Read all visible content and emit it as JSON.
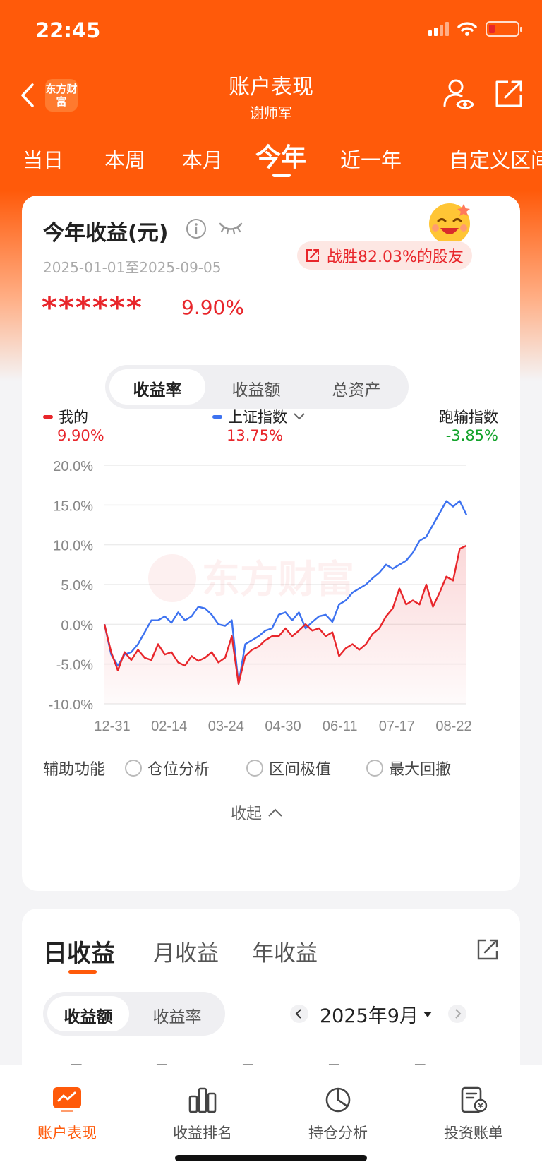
{
  "status_bar": {
    "time": "22:45"
  },
  "header": {
    "logo_text": "东方财富",
    "title": "账户表现",
    "subtitle": "谢师军"
  },
  "period_tabs": [
    {
      "label": "当日"
    },
    {
      "label": "本周"
    },
    {
      "label": "本月"
    },
    {
      "label": "今年",
      "active": true
    },
    {
      "label": "近一年"
    },
    {
      "label": "自定义区间"
    }
  ],
  "summary": {
    "title": "今年收益(元)",
    "date_range": "2025-01-01至2025-09-05",
    "badge": "战胜82.03%的股友",
    "masked_amount": "******",
    "rate": "9.90%",
    "segments": [
      "收益率",
      "收益额",
      "总资产"
    ],
    "selected_segment": "收益率"
  },
  "legend": {
    "mine": {
      "label": "我的",
      "value": "9.90%",
      "color": "#e8262b"
    },
    "index": {
      "label": "上证指数",
      "value": "13.75%",
      "color": "#3d72f0"
    },
    "diff": {
      "label": "跑输指数",
      "value": "-3.85%",
      "color": "#12a32a"
    }
  },
  "chart_data": {
    "type": "line",
    "watermark": "东方财富",
    "x_ticks": [
      "12-31",
      "02-14",
      "03-24",
      "04-30",
      "06-11",
      "07-17",
      "08-22"
    ],
    "y_ticks": [
      "20.0%",
      "15.0%",
      "10.0%",
      "5.0%",
      "0.0%",
      "-5.0%",
      "-10.0%"
    ],
    "ylim": [
      -10,
      20
    ],
    "series": [
      {
        "name": "我的",
        "color": "#e8262b",
        "values": [
          0,
          -3.5,
          -5.8,
          -3.5,
          -4.5,
          -3.2,
          -4.2,
          -4.5,
          -2.5,
          -3.8,
          -3.5,
          -4.8,
          -5.2,
          -4.0,
          -4.6,
          -4.2,
          -3.5,
          -4.8,
          -4.2,
          -1.5,
          -7.5,
          -4.0,
          -3.2,
          -2.8,
          -2.0,
          -1.5,
          -1.5,
          -0.5,
          -1.5,
          -0.8,
          0,
          -0.8,
          -0.5,
          -1.5,
          -1.0,
          -4.0,
          -3.0,
          -2.5,
          -3.2,
          -2.5,
          -1.2,
          -0.5,
          1.0,
          2.0,
          4.5,
          2.5,
          3.0,
          2.5,
          5.0,
          2.2,
          4.0,
          6.0,
          5.5,
          9.5,
          9.9
        ]
      },
      {
        "name": "上证指数",
        "color": "#3d72f0",
        "values": [
          0,
          -3.8,
          -5.2,
          -3.8,
          -3.5,
          -2.5,
          -1.0,
          0.5,
          0.5,
          1.0,
          0.2,
          1.5,
          0.5,
          1.0,
          2.2,
          2.0,
          1.2,
          0,
          -0.2,
          0.5,
          -7.5,
          -2.5,
          -2.0,
          -1.5,
          -0.8,
          -0.5,
          1.2,
          1.5,
          0.5,
          1.5,
          -0.5,
          0.3,
          1.0,
          1.2,
          0.3,
          2.5,
          3.0,
          4.0,
          4.5,
          5.0,
          5.8,
          6.5,
          7.5,
          7.0,
          7.5,
          8.0,
          9.0,
          10.5,
          11.0,
          12.5,
          14.0,
          15.5,
          14.8,
          15.5,
          13.75
        ]
      }
    ]
  },
  "aux": {
    "label": "辅助功能",
    "options": [
      "仓位分析",
      "区间极值",
      "最大回撤"
    ]
  },
  "collapse_label": "收起",
  "income": {
    "tabs": [
      "日收益",
      "月收益",
      "年收益"
    ],
    "active_tab": "日收益",
    "segments": [
      "收益额",
      "收益率"
    ],
    "month": "2025年9月",
    "weekdays": [
      "周一",
      "周二",
      "周三",
      "周四",
      "周五"
    ]
  },
  "bottom_nav": [
    {
      "label": "账户表现",
      "icon": "account-performance-icon",
      "active": true
    },
    {
      "label": "收益排名",
      "icon": "bar-chart-icon"
    },
    {
      "label": "持仓分析",
      "icon": "pie-chart-icon"
    },
    {
      "label": "投资账单",
      "icon": "bill-icon"
    }
  ],
  "colors": {
    "brand": "#ff5a0a",
    "red": "#e8262b",
    "blue": "#3d72f0",
    "green": "#12a32a"
  }
}
